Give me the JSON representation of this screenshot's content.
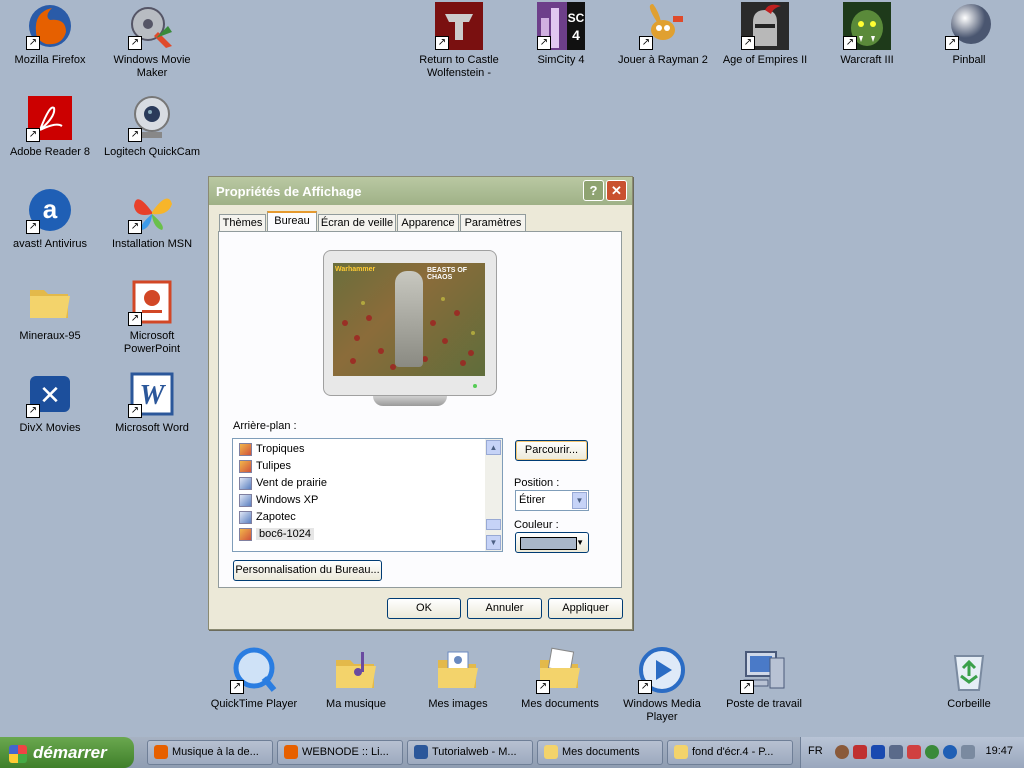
{
  "desktop": {
    "icons": [
      {
        "label": "Mozilla Firefox",
        "icon": "firefox-icon",
        "color": "#e66000"
      },
      {
        "label": "Windows Movie Maker",
        "icon": "movie-maker-icon",
        "color": "#7a8a9a"
      },
      {
        "label": "Adobe Reader 8",
        "icon": "adobe-reader-icon",
        "color": "#cc0000"
      },
      {
        "label": "Logitech QuickCam",
        "icon": "webcam-icon",
        "color": "#9aa0a8"
      },
      {
        "label": "avast! Antivirus",
        "icon": "avast-icon",
        "color": "#1f5fb5"
      },
      {
        "label": "Installation MSN",
        "icon": "msn-butterfly-icon",
        "color": "#3d9be9"
      },
      {
        "label": "Mineraux-95",
        "icon": "folder-icon",
        "color": "#f3d36b"
      },
      {
        "label": "Microsoft PowerPoint",
        "icon": "powerpoint-icon",
        "color": "#d24726"
      },
      {
        "label": "DivX Movies",
        "icon": "divx-icon",
        "color": "#1c4f9c"
      },
      {
        "label": "Microsoft Word",
        "icon": "word-icon",
        "color": "#2b579a"
      },
      {
        "label": "Return to Castle Wolfenstein -",
        "icon": "wolfenstein-icon",
        "color": "#7a1010"
      },
      {
        "label": "SimCity 4",
        "icon": "simcity-icon",
        "color": "#6d3f8a"
      },
      {
        "label": "Jouer à Rayman 2",
        "icon": "rayman-icon",
        "color": "#e0a030"
      },
      {
        "label": "Age of Empires II",
        "icon": "knight-helmet-icon",
        "color": "#8a1a1a"
      },
      {
        "label": "Warcraft III",
        "icon": "orc-icon",
        "color": "#3c6a2a"
      },
      {
        "label": "Pinball",
        "icon": "pinball-icon",
        "color": "#8a96b0"
      },
      {
        "label": "QuickTime Player",
        "icon": "quicktime-icon",
        "color": "#2a7de1"
      },
      {
        "label": "Ma musique",
        "icon": "music-folder-icon",
        "color": "#f3d36b"
      },
      {
        "label": "Mes images",
        "icon": "pictures-folder-icon",
        "color": "#f3d36b"
      },
      {
        "label": "Mes documents",
        "icon": "documents-folder-icon",
        "color": "#f3d36b"
      },
      {
        "label": "Windows Media Player",
        "icon": "media-player-icon",
        "color": "#2b6cc4"
      },
      {
        "label": "Poste de travail",
        "icon": "my-computer-icon",
        "color": "#6a8ac0"
      },
      {
        "label": "Corbeille",
        "icon": "recycle-bin-icon",
        "color": "#3aa04a"
      }
    ]
  },
  "dialog": {
    "title": "Propriétés de Affichage",
    "help": "?",
    "close": "✕",
    "tabs": [
      "Thèmes",
      "Bureau",
      "Écran de veille",
      "Apparence",
      "Paramètres"
    ],
    "preview": {
      "text1": "BEASTS OF CHAOS",
      "text2": "Warhammer"
    },
    "background_label": "Arrière-plan :",
    "list": [
      "Tropiques",
      "Tulipes",
      "Vent de prairie",
      "Windows XP",
      "Zapotec",
      "boc6-1024"
    ],
    "browse": "Parcourir...",
    "position_label": "Position :",
    "position_value": "Étirer",
    "color_label": "Couleur :",
    "color_value": "#a9b7ca",
    "customize": "Personnalisation du Bureau...",
    "ok": "OK",
    "cancel": "Annuler",
    "apply": "Appliquer"
  },
  "taskbar": {
    "start": "démarrer",
    "tasks": [
      {
        "label": "Musique à la de...",
        "color": "#e66000"
      },
      {
        "label": "WEBNODE :: Li...",
        "color": "#e66000"
      },
      {
        "label": "Tutorialweb - M...",
        "color": "#2b579a"
      },
      {
        "label": "Mes documents",
        "color": "#f3d36b"
      },
      {
        "label": "fond d'écr.4 - P...",
        "color": "#f3d36b"
      }
    ],
    "lang": "FR",
    "clock": "19:47"
  }
}
